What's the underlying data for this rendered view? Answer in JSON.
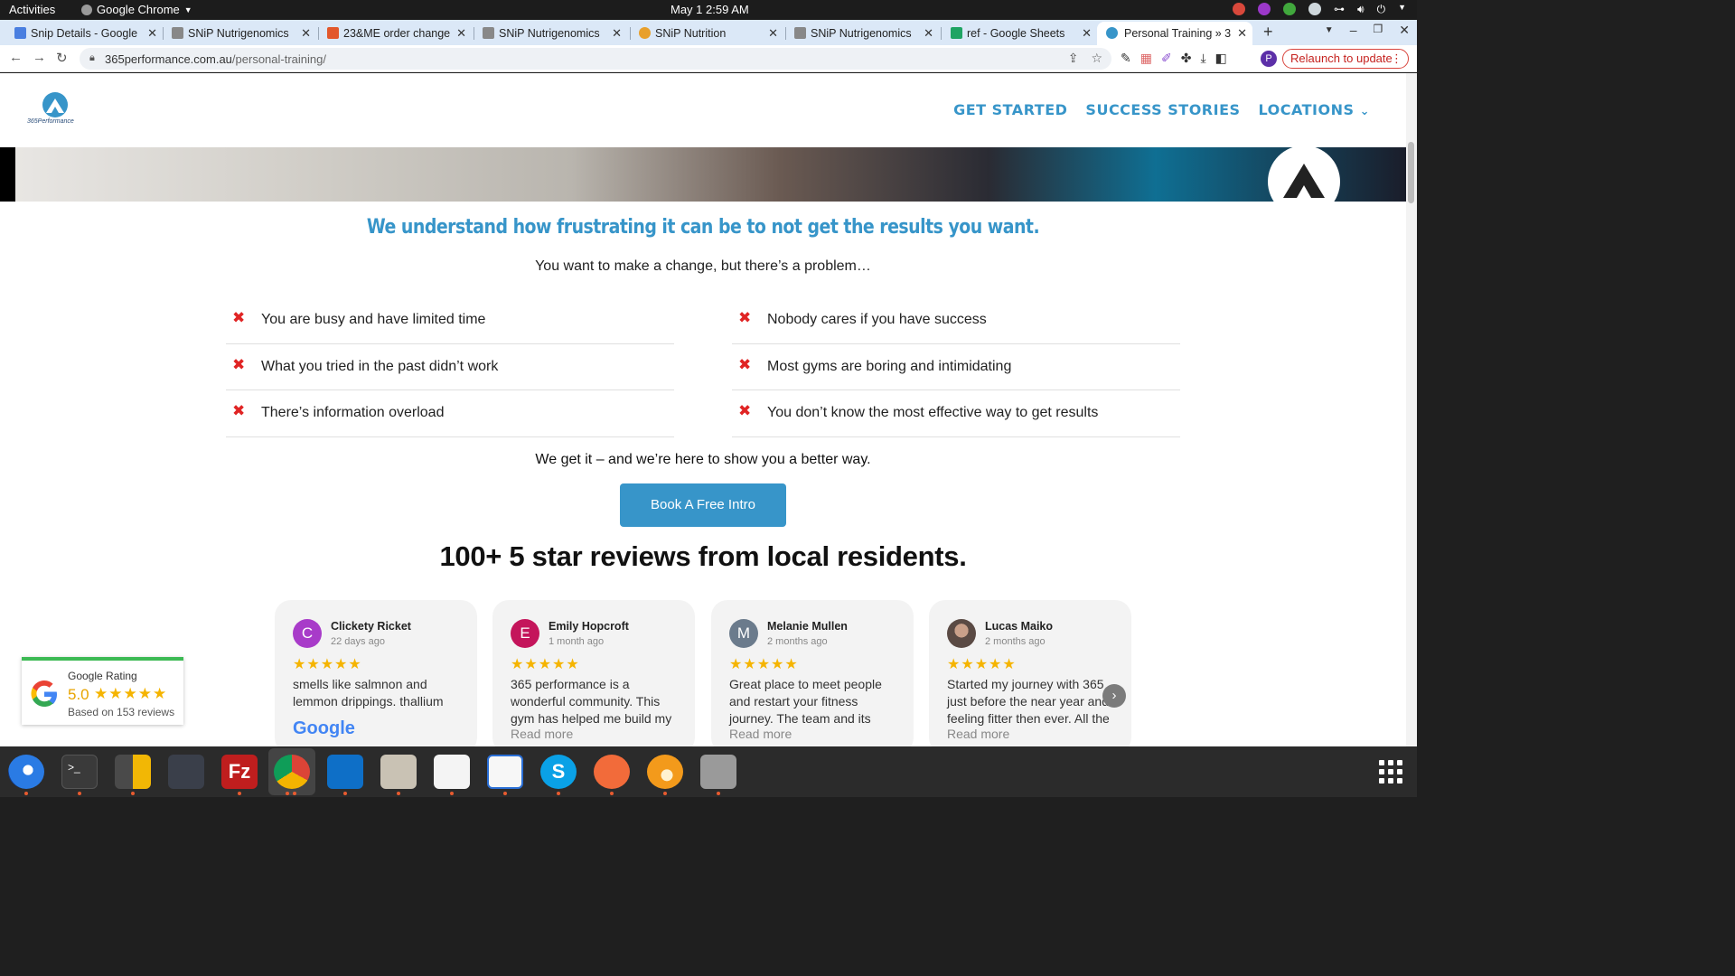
{
  "system": {
    "activities": "Activities",
    "app": "Google Chrome",
    "clock": "May 1  2:59 AM"
  },
  "tabs": [
    {
      "label": "Snip Details - Google",
      "color": "#4a7fe0"
    },
    {
      "label": "SNiP Nutrigenomics",
      "color": "#888888"
    },
    {
      "label": "23&ME order change",
      "color": "#e2582c"
    },
    {
      "label": "SNiP Nutrigenomics",
      "color": "#888888"
    },
    {
      "label": "SNiP Nutrition",
      "color": "#e8a02c"
    },
    {
      "label": "SNiP Nutrigenomics",
      "color": "#888888"
    },
    {
      "label": "ref - Google Sheets",
      "color": "#1fa463"
    },
    {
      "label": "Personal Training » 3",
      "color": "#3795c9"
    }
  ],
  "toolbar": {
    "url_domain": "365performance.com.au",
    "url_path": "/personal-training/",
    "relaunch": "Relaunch to update",
    "profile_initial": "P"
  },
  "site": {
    "logo_text": "365Performance",
    "nav": {
      "get_started": "GET STARTED",
      "success_stories": "SUCCESS STORIES",
      "locations": "LOCATIONS"
    },
    "headline": "We understand how frustrating it can be to not get the results you want.",
    "subhead": "You want to make a change, but there’s a problem…",
    "problems_left": [
      "You are busy and have limited time",
      "What you tried in the past didn’t work",
      "There’s information overload"
    ],
    "problems_right": [
      "Nobody cares if you have success",
      "Most gyms are boring and intimidating",
      "You don’t know the most effective way to get results"
    ],
    "get_it": "We get it – and we’re here to show you a better way.",
    "cta": "Book A Free Intro",
    "reviews_heading": "100+ 5 star reviews from local residents.",
    "reviews": [
      {
        "initial": "C",
        "name": "Clickety Ricket",
        "date": "22 days ago",
        "text": "smells like salmnon and lemmon drippings. thallium",
        "more": "",
        "color": "#a83bc9",
        "stars": 5
      },
      {
        "initial": "E",
        "name": "Emily Hopcroft",
        "date": "1 month ago",
        "text": "365 performance is a wonderful community. This gym has helped me build my",
        "more": "Read more",
        "color": "#c4155b",
        "stars": 5
      },
      {
        "initial": "M",
        "name": "Melanie Mullen",
        "date": "2 months ago",
        "text": "Great place to meet people and restart your fitness journey. The team and its",
        "more": "Read more",
        "color": "#6b7b8c",
        "stars": 5
      },
      {
        "initial": "",
        "name": "Lucas Maiko",
        "date": "2 months ago",
        "text": "Started my journey with 365 just before the near year and feeling fitter then ever. All the",
        "more": "Read more",
        "color": "#5a4a44",
        "stars": 5
      }
    ],
    "google_word": "Google",
    "rating": {
      "label": "Google Rating",
      "score": "5.0",
      "based": "Based on 153 reviews",
      "stars": 5
    }
  },
  "stars_glyph": "★★★★★",
  "dock": {
    "apps": [
      "thunderbird-icon",
      "terminal-icon",
      "calculator-icon",
      "system-monitor-icon",
      "filezilla-icon",
      "chrome-icon",
      "vscode-icon",
      "files-icon",
      "text-editor-icon",
      "libreoffice-writer-icon",
      "skype-icon",
      "postman-icon",
      "blender-icon",
      "disk-icon"
    ]
  }
}
